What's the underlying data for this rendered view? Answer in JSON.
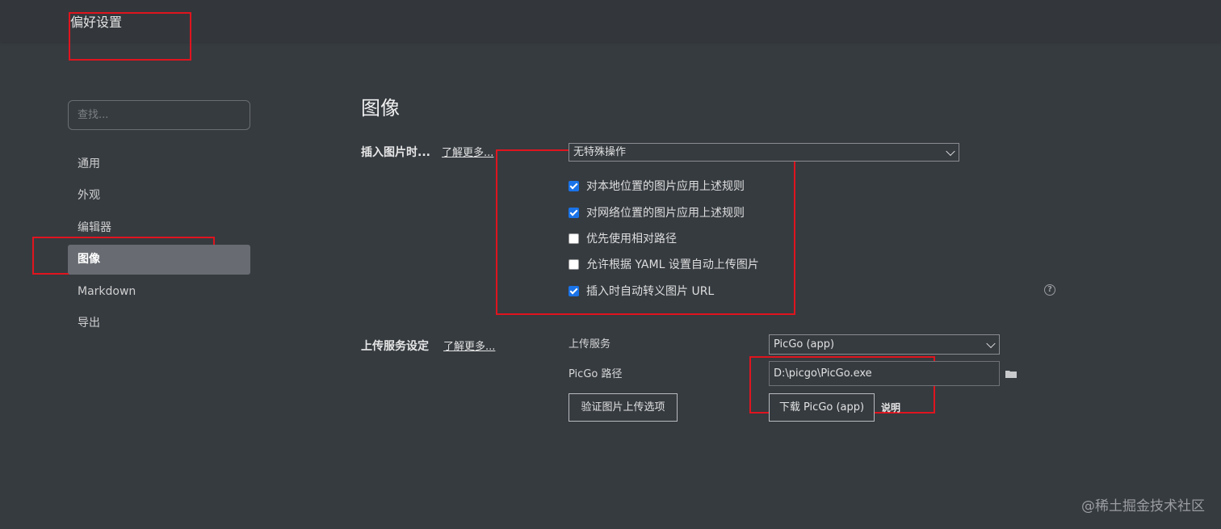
{
  "window": {
    "title": "偏好设置"
  },
  "sidebar": {
    "search_placeholder": "查找...",
    "items": [
      {
        "label": "通用"
      },
      {
        "label": "外观"
      },
      {
        "label": "编辑器"
      },
      {
        "label": "图像"
      },
      {
        "label": "Markdown"
      },
      {
        "label": "导出"
      }
    ],
    "active_item": "图像"
  },
  "main": {
    "title": "图像",
    "insert": {
      "label": "插入图片时...",
      "learn_more": "了解更多...",
      "action_select": "无特殊操作",
      "options": [
        {
          "label": "对本地位置的图片应用上述规则",
          "checked": true
        },
        {
          "label": "对网络位置的图片应用上述规则",
          "checked": true
        },
        {
          "label": "优先使用相对路径",
          "checked": false
        },
        {
          "label": "允许根据 YAML 设置自动上传图片",
          "checked": false
        },
        {
          "label": "插入时自动转义图片 URL",
          "checked": true
        }
      ],
      "help_icon": "?"
    },
    "upload": {
      "label": "上传服务设定",
      "learn_more": "了解更多...",
      "service_label": "上传服务",
      "service_value": "PicGo (app)",
      "path_label": "PicGo 路径",
      "path_value": "D:\\picgo\\PicGo.exe",
      "verify_button": "验证图片上传选项",
      "download_button": "下载 PicGo (app)",
      "help_link": "说明"
    }
  },
  "watermark": "@稀土掘金技术社区",
  "colors": {
    "background": "#363b40",
    "active_nav": "#686c72",
    "checkbox_on": "#1a73e8",
    "annotation_red": "#e0141e"
  }
}
